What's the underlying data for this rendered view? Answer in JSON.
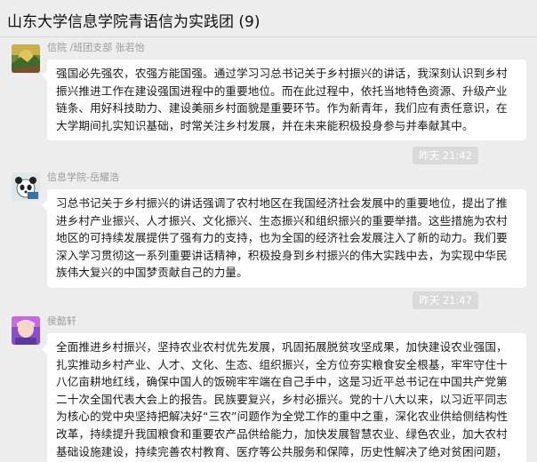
{
  "chat": {
    "title": "山东大学信息学院青语信为实践团 (9)"
  },
  "messages": [
    {
      "sender": "信院 /班团支部 张若怡",
      "avatar_icon": "landscape-avatar",
      "text": "强国必先强农，农强方能国强。通过学习习总书记关于乡村振兴的讲话，我深刻认识到乡村振兴推进工作在建设强国进程中的重要地位。而在此过程中，依托当地特色资源、升级产业链条、用好科技助力、建设美丽乡村面貌是重要环节。作为新青年，我们应有责任意识，在大学期间扎实知识基础，时常关注乡村发展，并在未来能积极投身参与并奉献其中。",
      "time": "昨天 21:42"
    },
    {
      "sender": "信息学院-岳耀浩",
      "avatar_icon": "panda-avatar",
      "text": "习总书记关于乡村振兴的讲话强调了农村地区在我国经济社会发展中的重要地位，提出了推进乡村产业振兴、人才振兴、文化振兴、生态振兴和组织振兴的重要举措。这些措施为农村地区的可持续发展提供了强有力的支持，也为全国的经济社会发展注入了新的动力。我们要深入学习贯彻这一系列重要讲话精神，积极投身到乡村振兴的伟大实践中去，为实现中华民族伟大复兴的中国梦贡献自己的力量。",
      "time": "昨天 21:47"
    },
    {
      "sender": "侯懿轩",
      "avatar_icon": "portrait-avatar",
      "text": "全面推进乡村振兴，坚持农业农村优先发展，巩固拓展脱贫攻坚成果，加快建设农业强国，扎实推动乡村产业、人才、文化、生态、组织振兴，全方位夯实粮食安全根基，牢牢守住十八亿亩耕地红线，确保中国人的饭碗牢牢端在自己手中，这是习近平总书记在中国共产党第二十次全国代表大会上的报告。民族要复兴，乡村必振兴。党的十八大以来，以习近平同志为核心的党中央坚持把解决好“三农”问题作为全党工作的重中之重，深化农业供给侧结构性改革，持续提升我国粮食和重要农产品供给能力，加快发展智慧农业、绿色农业，加大农村基础设施建设，持续完善农村教育、医疗等公共服务和保障，历史性解决了绝对贫困问题，巩固拓展了脱贫攻坚成果。"
    }
  ]
}
